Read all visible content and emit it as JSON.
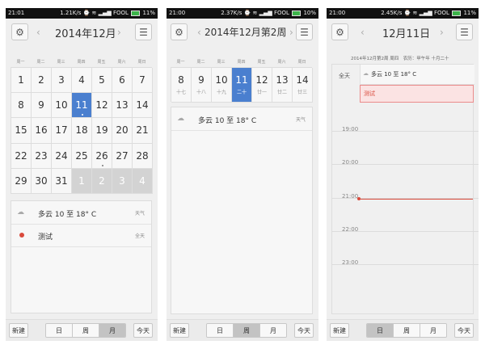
{
  "status_bars": [
    {
      "time": "21:01",
      "speed": "1.21K/s",
      "carrier": "FOOL",
      "battery": "11%"
    },
    {
      "time": "21:00",
      "speed": "2.37K/s",
      "carrier": "FOOL",
      "battery": "10%"
    },
    {
      "time": "21:00",
      "speed": "2.45K/s",
      "carrier": "FOOL",
      "battery": "11%"
    }
  ],
  "weekdays": [
    "周一",
    "周二",
    "周三",
    "周四",
    "周五",
    "周六",
    "周日"
  ],
  "screen1": {
    "title": "2014年12月",
    "rows": [
      [
        "1",
        "2",
        "3",
        "4",
        "5",
        "6",
        "7"
      ],
      [
        "8",
        "9",
        "10",
        "11",
        "12",
        "13",
        "14"
      ],
      [
        "15",
        "16",
        "17",
        "18",
        "19",
        "20",
        "21"
      ],
      [
        "22",
        "23",
        "24",
        "25",
        "26",
        "27",
        "28"
      ],
      [
        "29",
        "30",
        "31",
        "1",
        "2",
        "3",
        "4"
      ]
    ],
    "weather": "多云 10 至 18° C",
    "weather_tag": "天气",
    "event": "测试",
    "event_tag": "全天"
  },
  "screen2": {
    "title": "2014年12月第2周",
    "days": [
      "8",
      "9",
      "10",
      "11",
      "12",
      "13",
      "14"
    ],
    "lunar": [
      "十七",
      "十八",
      "十九",
      "二十",
      "廿一",
      "廿二",
      "廿三"
    ],
    "weather": "多云 10 至 18° C",
    "weather_tag": "天气"
  },
  "screen3": {
    "title": "12月11日",
    "subtitle": "2014年12月第2周 周四　农历：甲午年 十月二十",
    "allday_label": "全天",
    "weather": "多云 10 至 18° C",
    "event": "测试",
    "times": [
      "19:00",
      "20:00",
      "21:00",
      "22:00",
      "23:00"
    ]
  },
  "bottom": {
    "new": "新建",
    "day": "日",
    "week": "周",
    "month": "月",
    "today": "今天"
  },
  "icons": {
    "settings": "gear-icon",
    "menu": "menu-icon",
    "prev": "chevron-left-icon",
    "next": "chevron-right-icon",
    "weather": "cloud-icon"
  },
  "colors": {
    "selected": "#4a7fcf",
    "event_red": "#d94a3c",
    "event_bg": "#fbe3e3",
    "status_bar": "#111111"
  }
}
